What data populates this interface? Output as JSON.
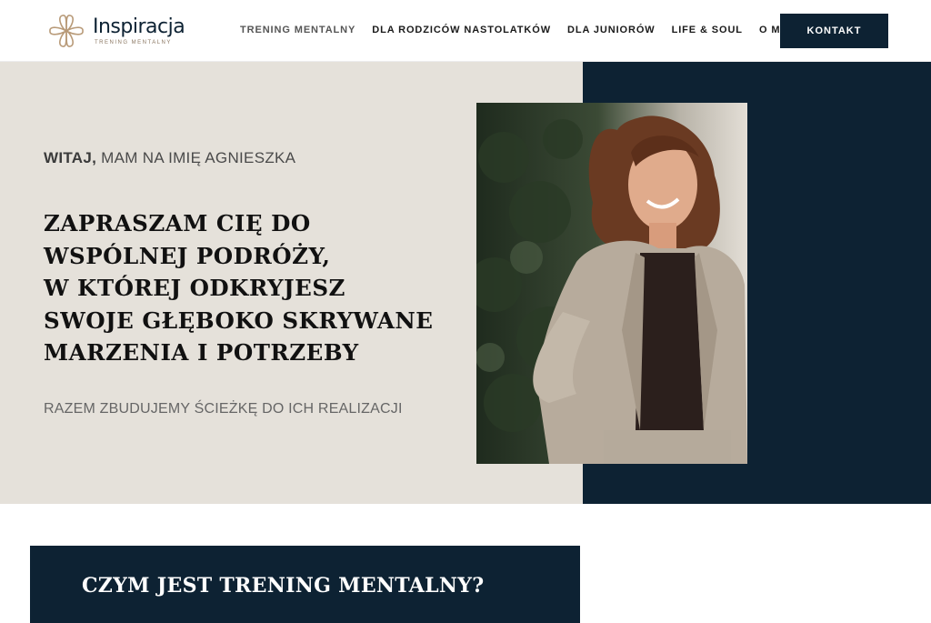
{
  "brand": {
    "name": "Inspiracja",
    "tagline": "TRENING MENTALNY"
  },
  "nav": {
    "items": [
      {
        "label": "TRENING MENTALNY"
      },
      {
        "label": "DLA RODZICÓW NASTOLATKÓW"
      },
      {
        "label": "DLA JUNIORÓW"
      },
      {
        "label": "LIFE & SOUL"
      },
      {
        "label": "O MNIE"
      }
    ],
    "cta": "KONTAKT"
  },
  "hero": {
    "greeting_bold": "WITAJ,",
    "greeting_rest": " MAM NA IMIĘ AGNIESZKA",
    "headline_lines": [
      "ZAPRASZAM CIĘ DO",
      "WSPÓLNEJ PODRÓŻY,",
      "W KTÓREJ ODKRYJESZ",
      "SWOJE GŁĘBOKO SKRYWANE",
      "MARZENIA I POTRZEBY"
    ],
    "subline": "RAZEM ZBUDUJEMY ŚCIEŻKĘ DO ICH REALIZACJI"
  },
  "section2": {
    "title": "CZYM JEST TRENING MENTALNY?"
  },
  "colors": {
    "navy": "#0d2233",
    "beige": "#e5e1da",
    "logo_gold": "#b89a78"
  }
}
